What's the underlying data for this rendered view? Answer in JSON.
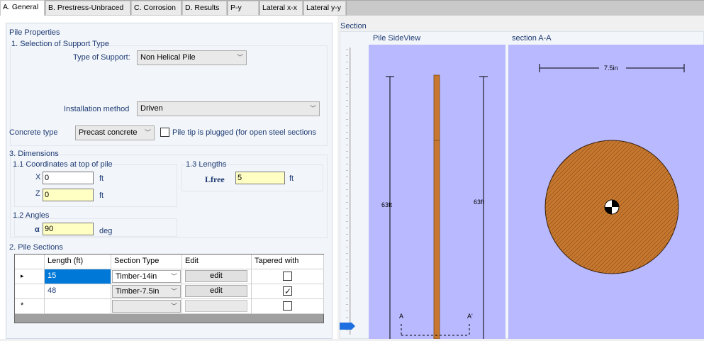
{
  "tabs": [
    {
      "label": "A. General",
      "active": true
    },
    {
      "label": "B. Prestress-Unbraced",
      "active": false
    },
    {
      "label": "C. Corrosion",
      "active": false
    },
    {
      "label": "D. Results",
      "active": false
    },
    {
      "label": "P-y",
      "active": false
    },
    {
      "label": "Lateral x-x",
      "active": false
    },
    {
      "label": "Lateral y-y",
      "active": false
    }
  ],
  "pile_properties": {
    "title": "Pile Properties",
    "support_group_title": "1. Selection of Support Type",
    "type_of_support_label": "Type of Support:",
    "type_of_support_value": "Non Helical Pile",
    "installation_method_label": "Installation method",
    "installation_method_value": "Driven",
    "concrete_type_label": "Concrete type",
    "concrete_type_value": "Precast concrete",
    "pile_tip_plugged_label": "Pile tip is plugged (for open steel sections",
    "pile_tip_plugged_checked": false
  },
  "dimensions": {
    "title": "3. Dimensions",
    "coords_title": "1.1 Coordinates at top of pile",
    "x_label": "X",
    "x_value": "0",
    "x_unit": "ft",
    "z_label": "Z",
    "z_value": "0",
    "z_unit": "ft",
    "angles_title": "1.2 Angles",
    "alpha_label": "α",
    "alpha_value": "90",
    "alpha_unit": "deg",
    "lengths_title": "1.3 Lengths",
    "lfree_label": "Lfree",
    "lfree_value": "5",
    "lfree_unit": "ft"
  },
  "pile_sections": {
    "title": "2. Pile Sections",
    "columns": [
      "Length (ft)",
      "Section Type",
      "Edit",
      "Tapered with"
    ],
    "rows": [
      {
        "marker": "▸",
        "length": "15",
        "section_type": "Timber-14in",
        "edit": "edit",
        "tapered": false
      },
      {
        "marker": "",
        "length": "48",
        "section_type": "Timber-7.5in",
        "edit": "edit",
        "tapered": true
      },
      {
        "marker": "*",
        "length": "",
        "section_type": "",
        "edit": "",
        "tapered": false
      }
    ]
  },
  "section_view": {
    "title": "Section",
    "side_view_title": "Pile SideView",
    "section_aa_title": "section A-A",
    "dim_left_label": "63ft",
    "dim_right_label": "63ft",
    "marker_a_left": "A",
    "marker_a_right": "A'",
    "diameter_label": "7.5in"
  },
  "colors": {
    "panel_bg": "#b9b9ff",
    "pile_fill": "#c8782e",
    "highlight_yellow": "#ffffc4",
    "label_blue": "#1e3b74",
    "selection_blue": "#0078d7"
  }
}
